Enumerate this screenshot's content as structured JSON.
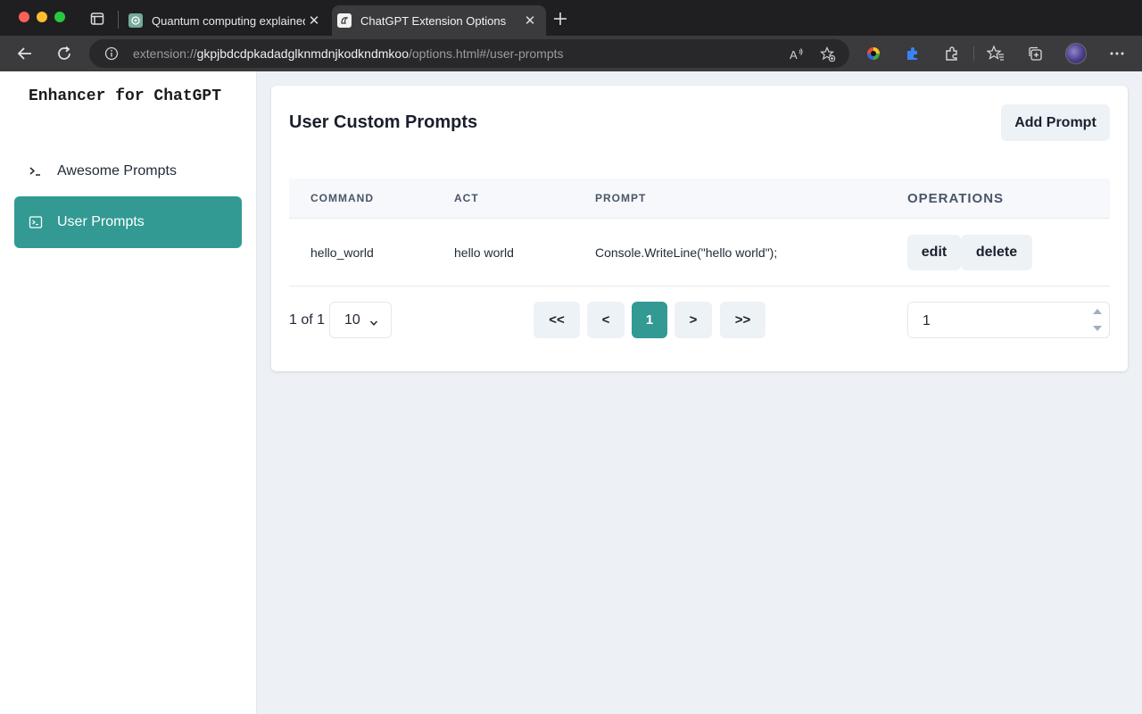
{
  "browser": {
    "tabs": [
      {
        "title": "Quantum computing explained",
        "active": false
      },
      {
        "title": "ChatGPT Extension Options",
        "active": true
      }
    ],
    "close_glyph": "✕",
    "url": {
      "scheme": "extension://",
      "host": "gkpjbdcdpkadadglknmdnjkodkndmkoo",
      "path": "/options.html#/user-prompts"
    }
  },
  "sidebar": {
    "brand": "Enhancer for ChatGPT",
    "items": [
      {
        "label": "Awesome Prompts",
        "icon": "terminal-icon",
        "active": false
      },
      {
        "label": "User Prompts",
        "icon": "terminal-box-icon",
        "active": true
      }
    ]
  },
  "main": {
    "title": "User Custom Prompts",
    "add_button": "Add Prompt",
    "table": {
      "columns": [
        "COMMAND",
        "ACT",
        "PROMPT",
        "OPERATIONS"
      ],
      "rows": [
        {
          "command": "hello_world",
          "act": "hello world",
          "prompt": "Console.WriteLine(\"hello world\");",
          "edit": "edit",
          "delete": "delete"
        }
      ]
    },
    "pagination": {
      "info": "1 of 1",
      "page_size": "10",
      "first": "<<",
      "prev": "<",
      "current": "1",
      "next": ">",
      "last": ">>",
      "goto_value": "1"
    }
  },
  "colors": {
    "accent": "#329a93",
    "page_bg": "#edf1f5",
    "button_bg": "#edf2f7",
    "chrome_dark": "#1f1f21",
    "chrome_toolbar": "#3b3b3d"
  }
}
